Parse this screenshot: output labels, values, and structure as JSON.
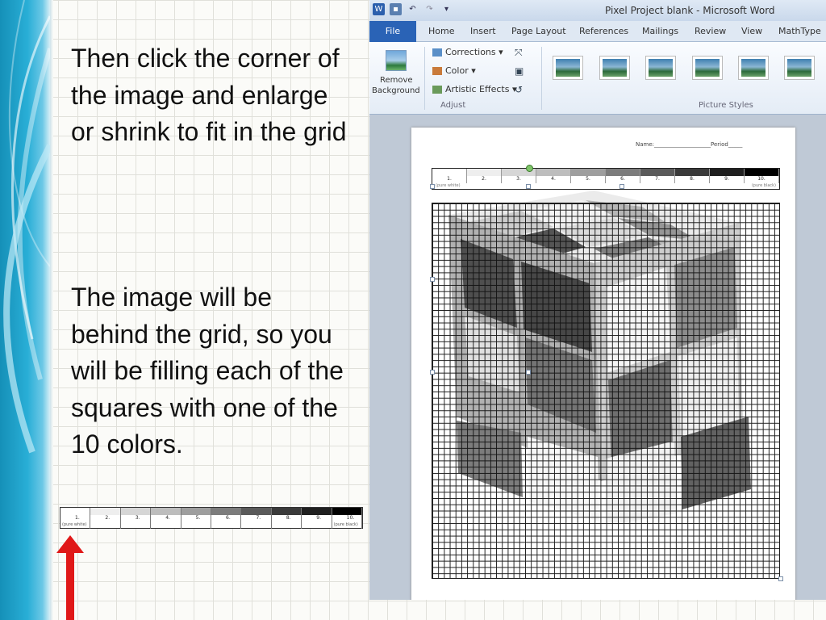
{
  "slide": {
    "paragraph1": "Then click the corner of the image and enlarge or shrink to fit in the grid",
    "paragraph2": "The image will be behind the grid, so you will be filling each of the squares with one of the 10 colors.",
    "legend": {
      "numbers": [
        "1.",
        "2.",
        "3.",
        "4.",
        "5.",
        "6.",
        "7.",
        "8.",
        "9.",
        "10."
      ],
      "first_sub": "(pure white)",
      "last_sub": "(pure black)",
      "colors": [
        "#ffffff",
        "#eeeeee",
        "#d6d6d6",
        "#bdbdbd",
        "#9e9e9e",
        "#7c7c7c",
        "#5a5a5a",
        "#3a3a3a",
        "#1f1f1f",
        "#000000"
      ]
    }
  },
  "word": {
    "title": "Pixel Project blank - Microsoft Word",
    "tabs": [
      "File",
      "Home",
      "Insert",
      "Page Layout",
      "References",
      "Mailings",
      "Review",
      "View",
      "MathType"
    ],
    "ribbon": {
      "remove_background_1": "Remove",
      "remove_background_2": "Background",
      "corrections": "Corrections",
      "color": "Color",
      "artistic_effects": "Artistic Effects",
      "adjust_group": "Adjust",
      "picture_styles_group": "Picture Styles"
    },
    "document": {
      "name_line": "Name:____________________Period_____",
      "legend_numbers": [
        "1.",
        "2.",
        "3.",
        "4.",
        "5.",
        "6.",
        "7.",
        "8.",
        "9.",
        "10."
      ],
      "legend_sub_left": "(pure white)",
      "legend_sub_right": "(pure black)"
    }
  },
  "colors": {
    "file_tab": "#2a63b6",
    "slide_band": "#29aed6",
    "arrow": "#e01818"
  }
}
